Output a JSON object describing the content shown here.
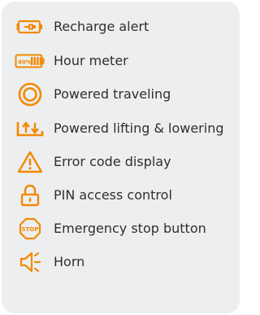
{
  "accent_color": "#f18a00",
  "features": [
    {
      "icon": "battery-plug-icon",
      "label": "Recharge alert"
    },
    {
      "icon": "battery-percent-icon",
      "label": "Hour meter",
      "icon_text": "40%"
    },
    {
      "icon": "concentric-circle-icon",
      "label": "Powered traveling"
    },
    {
      "icon": "lift-arrows-icon",
      "label": "Powered lifting & lowering"
    },
    {
      "icon": "warning-triangle-icon",
      "label": "Error code display"
    },
    {
      "icon": "padlock-icon",
      "label": "PIN access control"
    },
    {
      "icon": "stop-sign-icon",
      "label": "Emergency stop button",
      "icon_text": "STOP"
    },
    {
      "icon": "horn-icon",
      "label": "Horn"
    }
  ]
}
